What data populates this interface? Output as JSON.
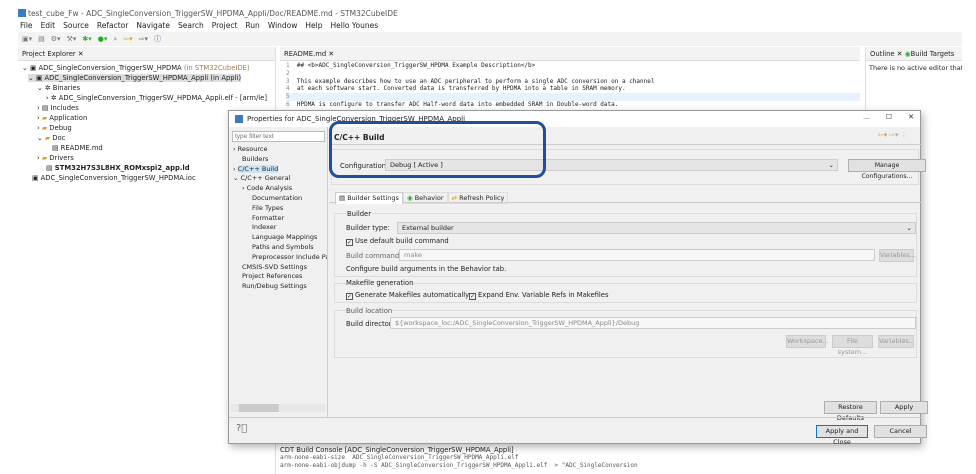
{
  "window": {
    "title": "test_cube_Fw - ADC_SingleConversion_TriggerSW_HPDMA_Appli/Doc/README.md - STM32CubeIDE"
  },
  "menu": [
    "File",
    "Edit",
    "Source",
    "Refactor",
    "Navigate",
    "Search",
    "Project",
    "Run",
    "Window",
    "Help"
  ],
  "user": "Hello Younes",
  "project_explorer": {
    "title": "Project Explorer",
    "items": [
      {
        "label": "ADC_SingleConversion_TriggerSW_HPDMA",
        "suffix": "(in STM32CubeIDE)"
      },
      {
        "label": "ADC_SingleConversion_TriggerSW_HPDMA_Appli (in Appli)"
      },
      {
        "label": "Binaries"
      },
      {
        "label": "ADC_SingleConversion_TriggerSW_HPDMA_Appli.elf - [arm/le]"
      },
      {
        "label": "Includes"
      },
      {
        "label": "Application"
      },
      {
        "label": "Debug"
      },
      {
        "label": "Doc"
      },
      {
        "label": "README.md"
      },
      {
        "label": "Drivers"
      },
      {
        "label": "STM32H7S3L8HX_ROMxspi2_app.ld"
      },
      {
        "label": "ADC_SingleConversion_TriggerSW_HPDMA.ioc"
      }
    ]
  },
  "editor": {
    "tab": "README.md",
    "lines": [
      {
        "n": "1",
        "t": "## <b>ADC_SingleConversion_TriggerSW_HPDMA Example Description</b>"
      },
      {
        "n": "2",
        "t": ""
      },
      {
        "n": "3",
        "t": "This example describes how to use an ADC peripheral to perform a single ADC conversion on a channel"
      },
      {
        "n": "4",
        "t": "at each software start. Converted data is transferred by HPDMA into a table in SRAM memory."
      },
      {
        "n": "5",
        "t": ""
      },
      {
        "n": "6",
        "t": "HPDMA is configure to transfer ADC Half-word data into embedded SRAM in Double-word data."
      }
    ]
  },
  "outline": {
    "tab": "Outline",
    "tab2": "Build Targets",
    "message": "There is no active editor that provides an outline."
  },
  "console": {
    "title": "CDT Build Console [ADC_SingleConversion_TriggerSW_HPDMA_Appli]",
    "line1": "arm-none-eabi-size  ADC_SingleConversion_TriggerSW_HPDMA_Appli.elf",
    "line2": "arm-none-eabi-objdump -h -S ADC_SingleConversion_TriggerSW_HPDMA_Appli.elf  > \"ADC_SingleConversion"
  },
  "dialog": {
    "title": "Properties for ADC_SingleConversion_TriggerSW_HPDMA_Appli",
    "filter_placeholder": "type filter text",
    "tree": [
      "Resource",
      "Builders",
      "C/C++ Build",
      "C/C++ General",
      "Code Analysis",
      "Documentation",
      "File Types",
      "Formatter",
      "Indexer",
      "Language Mappings",
      "Paths and Symbols",
      "Preprocessor Include Pat",
      "CMSIS-SVD Settings",
      "Project References",
      "Run/Debug Settings"
    ],
    "page_title": "C/C++ Build",
    "config_label": "Configuration:",
    "config_value": "Debug  [ Active ]",
    "manage_btn": "Manage Configurations...",
    "tabs": [
      "Builder Settings",
      "Behavior",
      "Refresh Policy"
    ],
    "builder_group": "Builder",
    "builder_type_label": "Builder type:",
    "builder_type": "External builder",
    "use_default": "Use default build command",
    "build_cmd_label": "Build command:",
    "build_cmd": "make",
    "variables": "Variables...",
    "configure_note": "Configure build arguments in the Behavior tab.",
    "makefile_group": "Makefile generation",
    "gen_makefiles": "Generate Makefiles automatically",
    "expand_env": "Expand Env. Variable Refs in Makefiles",
    "location_group": "Build location",
    "build_dir_label": "Build directory:",
    "build_dir": "${workspace_loc:/ADC_SingleConversion_TriggerSW_HPDMA_Appli}/Debug",
    "workspace_btn": "Workspace...",
    "filesystem_btn": "File system...",
    "restore": "Restore Defaults",
    "apply": "Apply",
    "apply_close": "Apply and Close",
    "cancel": "Cancel",
    "highlight_color": "#1f4e9c"
  }
}
